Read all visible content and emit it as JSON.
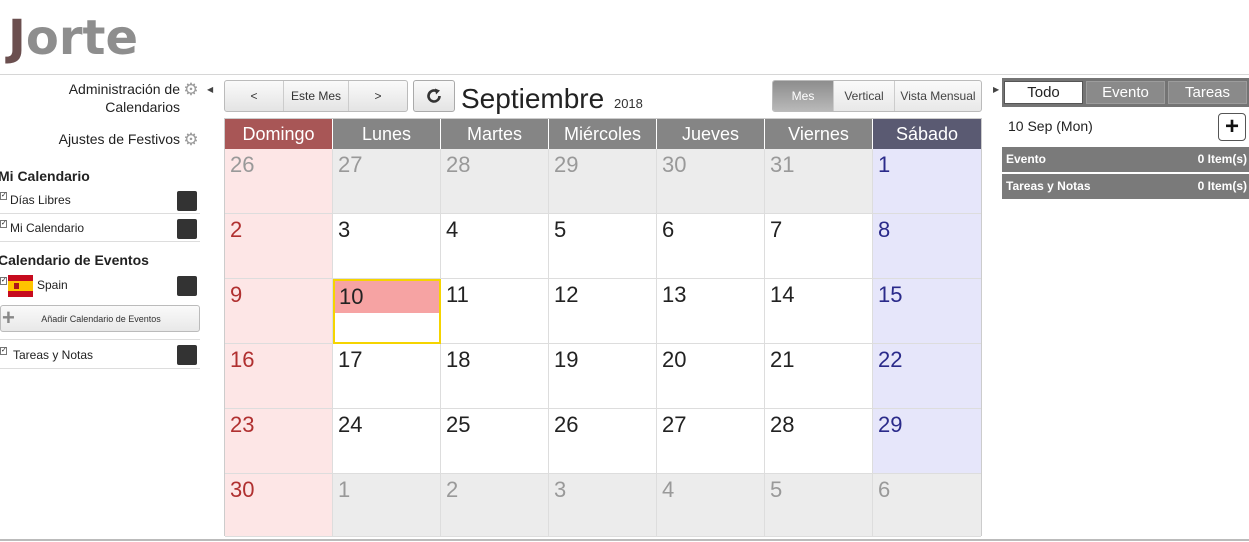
{
  "app": {
    "logo_first": "J",
    "logo_rest": "orte"
  },
  "sidebar": {
    "admin_calendars": "Administración de Calendarios",
    "holiday_settings": "Ajustes de Festivos",
    "my_calendar_section": "Mi Calendario",
    "my_calendar_items": [
      {
        "label": "Días Libres",
        "color": "#333333"
      },
      {
        "label": "Mi Calendario",
        "color": "#333333"
      }
    ],
    "events_section": "Calendario de Eventos",
    "events_items": [
      {
        "label": "Spain",
        "color": "#333333"
      }
    ],
    "add_event_calendar": "Añadir Calendario de Eventos",
    "tasks_item": {
      "label": "Tareas y Notas",
      "color": "#333333"
    }
  },
  "toolbar": {
    "prev": "<",
    "this_month": "Este Mes",
    "next": ">",
    "month": "Septiembre",
    "year": "2018",
    "views": [
      "Mes",
      "Vertical",
      "Vista Mensual"
    ],
    "active_view": "Mes"
  },
  "calendar": {
    "weekdays": [
      "Domingo",
      "Lunes",
      "Martes",
      "Miércoles",
      "Jueves",
      "Viernes",
      "Sábado"
    ],
    "weeks": [
      [
        "26",
        "27",
        "28",
        "29",
        "30",
        "31",
        "1"
      ],
      [
        "2",
        "3",
        "4",
        "5",
        "6",
        "7",
        "8"
      ],
      [
        "9",
        "10",
        "11",
        "12",
        "13",
        "14",
        "15"
      ],
      [
        "16",
        "17",
        "18",
        "19",
        "20",
        "21",
        "22"
      ],
      [
        "23",
        "24",
        "25",
        "26",
        "27",
        "28",
        "29"
      ],
      [
        "30",
        "1",
        "2",
        "3",
        "4",
        "5",
        "6"
      ]
    ],
    "today": "10",
    "colors": {
      "sunday_header": "#a85656",
      "saturday_header": "#5a5a72",
      "today_highlight": "#f6a3a3",
      "today_border": "#f5d400"
    }
  },
  "right_panel": {
    "tabs": [
      "Todo",
      "Evento",
      "Tareas"
    ],
    "active_tab": "Todo",
    "selected_date": "10 Sep (Mon)",
    "rows": [
      {
        "label": "Evento",
        "count": "0 Item(s)"
      },
      {
        "label": "Tareas y Notas",
        "count": "0 Item(s)"
      }
    ]
  }
}
